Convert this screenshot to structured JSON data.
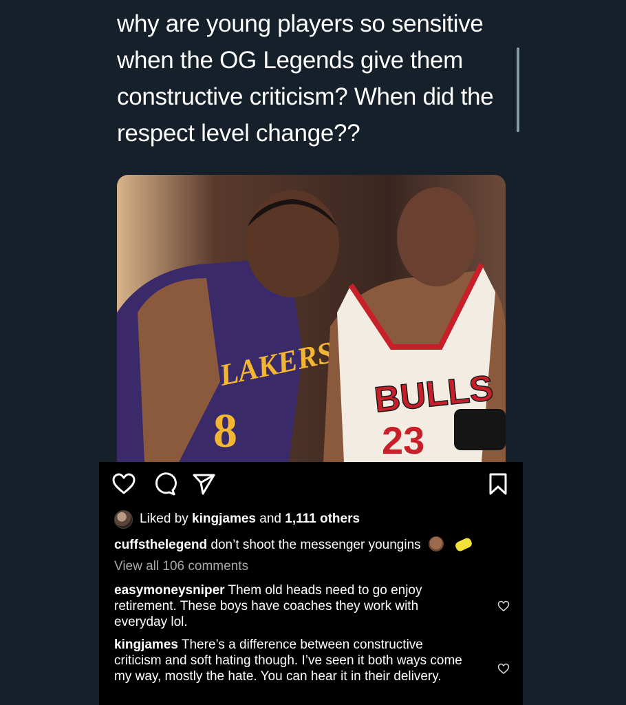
{
  "tweet": {
    "text": "why are young players so sensitive when the OG Legends give them constructive criticism? When did the respect level change??"
  },
  "post": {
    "likes": {
      "prefix": "Liked by ",
      "user": "kingjames",
      "middle": " and ",
      "count": "1,111 others"
    },
    "caption": {
      "user": "cuffsthelegend",
      "text": " don’t shoot the messenger youngins"
    },
    "view_all": "View all 106 comments",
    "comments": [
      {
        "user": "easymoneysniper",
        "text": " Them old heads need to go enjoy retirement. These boys have coaches they work with everyday lol."
      },
      {
        "user": "kingjames",
        "text": " There’s a difference between constructive criticism and soft hating though. I’ve seen it both ways come my way, mostly the hate. You can hear it in their delivery."
      }
    ],
    "photo_text": {
      "left_jersey": "LAKERS",
      "left_number": "8",
      "right_jersey": "BULLS",
      "right_number": "23"
    }
  },
  "icons": [
    "heart-icon",
    "comment-icon",
    "share-icon",
    "bookmark-icon",
    "avatar",
    "emoji-face",
    "emoji-sponge",
    "comment-heart-icon"
  ],
  "colors": {
    "background": "#15202b",
    "card": "#000000",
    "text": "#ffffff",
    "muted": "#a8a8a8"
  }
}
